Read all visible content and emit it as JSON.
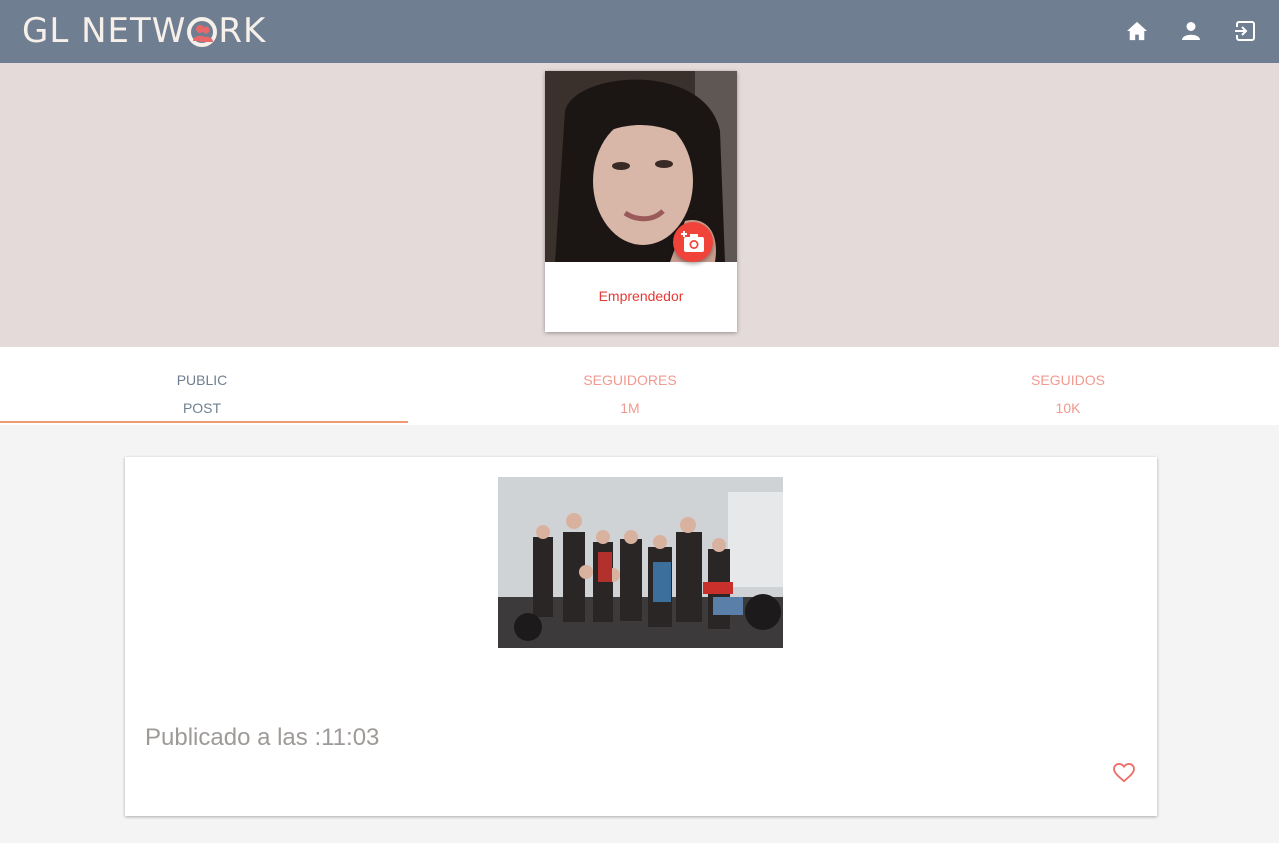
{
  "header": {
    "logo_prefix": "GL NETW",
    "logo_suffix": "RK",
    "icons": [
      "home-icon",
      "person-icon",
      "logout-icon"
    ],
    "bg_color": "#6f7f91"
  },
  "profile": {
    "role": "Emprendedor",
    "camera_button_icon": "add-photo-icon"
  },
  "tabs": [
    {
      "line1": "PUBLIC",
      "line2": "POST",
      "active": true
    },
    {
      "line1": "SEGUIDORES",
      "line2": "1M",
      "active": false
    },
    {
      "line1": "SEGUIDOS",
      "line2": "10K",
      "active": false
    }
  ],
  "post": {
    "time_text": "Publicado a las :11:03",
    "like_icon": "heart-outline-icon"
  },
  "colors": {
    "accent": "#e53935",
    "tab_inactive": "#f09a90",
    "hero_bg": "#e4dad9"
  }
}
